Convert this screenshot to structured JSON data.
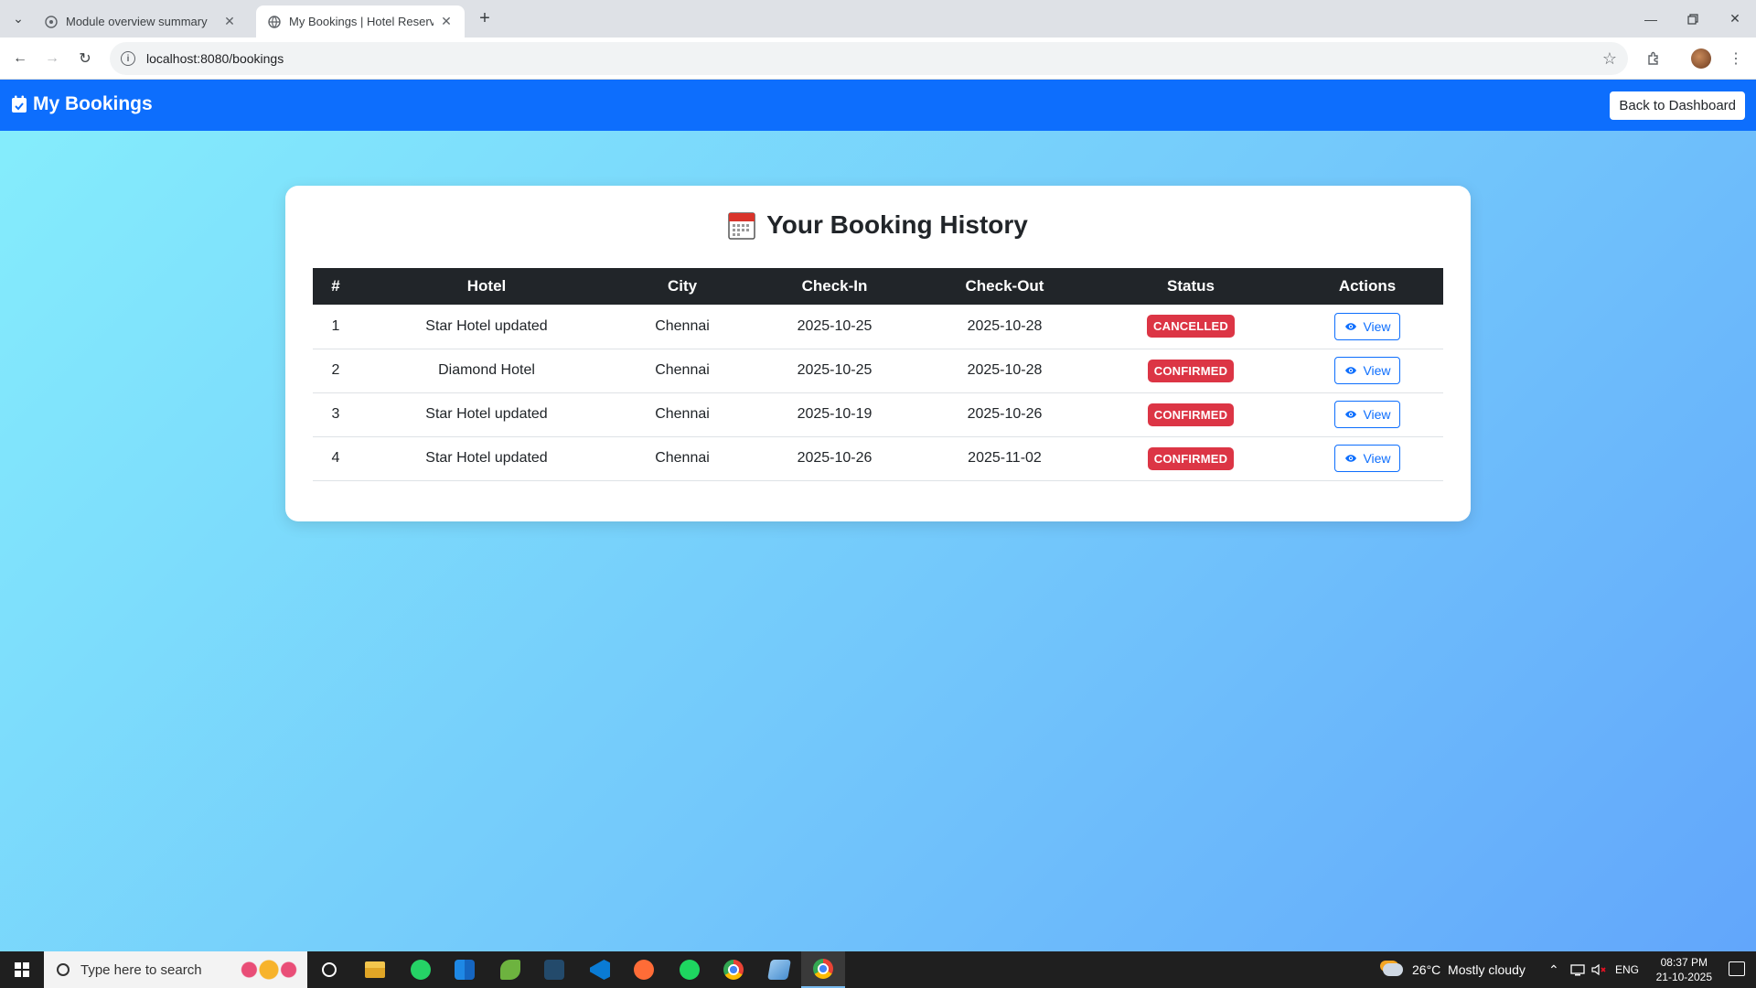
{
  "browser": {
    "tabs": [
      {
        "title": "Module overview summary",
        "active": false
      },
      {
        "title": "My Bookings | Hotel Reservatio",
        "active": true
      }
    ],
    "url": "localhost:8080/bookings"
  },
  "app": {
    "brand": "My Bookings",
    "back_button": "Back to Dashboard",
    "primary_color": "#0d6efd"
  },
  "card": {
    "title": "Your Booking History"
  },
  "table": {
    "headers": [
      "#",
      "Hotel",
      "City",
      "Check-In",
      "Check-Out",
      "Status",
      "Actions"
    ],
    "rows": [
      {
        "num": "1",
        "hotel": "Star Hotel updated",
        "city": "Chennai",
        "check_in": "2025-10-25",
        "check_out": "2025-10-28",
        "status": "CANCELLED",
        "action": "View"
      },
      {
        "num": "2",
        "hotel": "Diamond Hotel",
        "city": "Chennai",
        "check_in": "2025-10-25",
        "check_out": "2025-10-28",
        "status": "CONFIRMED",
        "action": "View"
      },
      {
        "num": "3",
        "hotel": "Star Hotel updated",
        "city": "Chennai",
        "check_in": "2025-10-19",
        "check_out": "2025-10-26",
        "status": "CONFIRMED",
        "action": "View"
      },
      {
        "num": "4",
        "hotel": "Star Hotel updated",
        "city": "Chennai",
        "check_in": "2025-10-26",
        "check_out": "2025-11-02",
        "status": "CONFIRMED",
        "action": "View"
      }
    ]
  },
  "taskbar": {
    "search_placeholder": "Type here to search",
    "weather": "26°C  Mostly cloudy",
    "language": "ENG",
    "time": "08:37 PM",
    "date": "21-10-2025",
    "apps": [
      "cortana-icon",
      "file-explorer-icon",
      "whatsapp-icon",
      "store-icon",
      "spring-icon",
      "mysql-workbench-icon",
      "vscode-icon",
      "postman-icon",
      "spotify-icon",
      "chrome-icon",
      "notepad-icon",
      "chrome-active-icon"
    ]
  }
}
